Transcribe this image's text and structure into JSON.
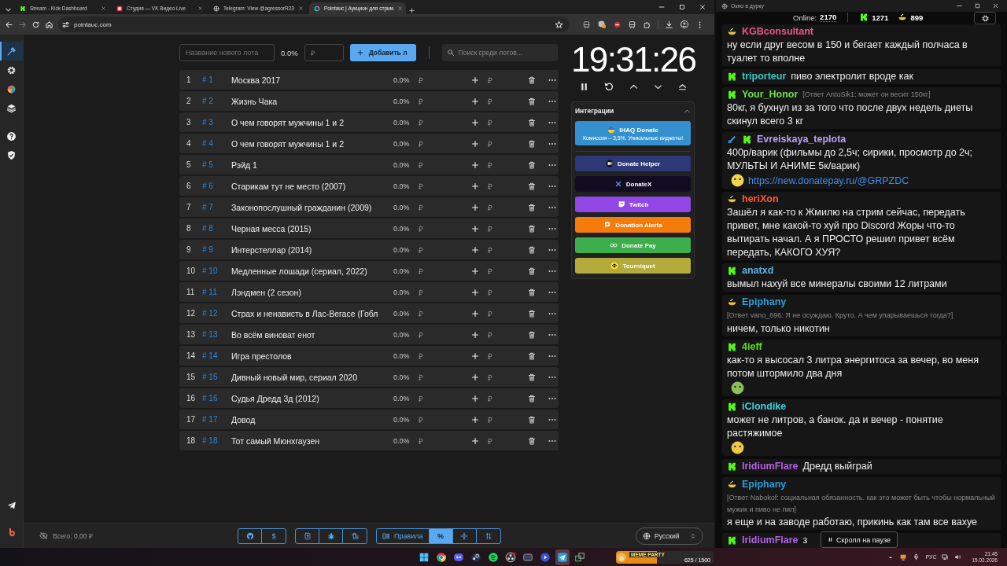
{
  "browser": {
    "tabs": [
      {
        "title": "Stream - Kick Dashboard",
        "selected": false
      },
      {
        "title": "Студия — VK Видео Live",
        "selected": false
      },
      {
        "title": "Telegram: View @agressorR23",
        "selected": false
      },
      {
        "title": "Pointauc | Аукцион для стрим",
        "selected": true
      }
    ],
    "url": "pointauc.com"
  },
  "auction": {
    "sidebar": {
      "items": [
        {
          "selected": true
        },
        {
          "selected": false
        },
        {
          "selected": false
        },
        {
          "selected": false
        }
      ]
    },
    "new_lot": {
      "name_placeholder": "Название нового лота",
      "percent": "0.0%",
      "amount_placeholder": "₽",
      "add_button": "Добавить л"
    },
    "search": {
      "placeholder": "Поиск среди лотов..."
    },
    "lots": [
      {
        "number": "1",
        "id": "# 1",
        "name": "Москва 2017",
        "percent": "0.0%",
        "currency": "₽",
        "add_placeholder": "₽"
      },
      {
        "number": "2",
        "id": "# 2",
        "name": "Жизнь Чака",
        "percent": "0.0%",
        "currency": "₽",
        "add_placeholder": "₽"
      },
      {
        "number": "3",
        "id": "# 3",
        "name": "О чем говорят мужчины 1 и 2",
        "percent": "0.0%",
        "currency": "₽",
        "add_placeholder": "₽"
      },
      {
        "number": "4",
        "id": "# 4",
        "name": "О чем говорят мужчины 1 и 2",
        "percent": "0.0%",
        "currency": "₽",
        "add_placeholder": "₽"
      },
      {
        "number": "5",
        "id": "# 5",
        "name": "Рэйд 1",
        "percent": "0.0%",
        "currency": "₽",
        "add_placeholder": "₽"
      },
      {
        "number": "6",
        "id": "# 6",
        "name": "Старикам тут не место (2007)",
        "percent": "0.0%",
        "currency": "₽",
        "add_placeholder": "₽"
      },
      {
        "number": "7",
        "id": "# 7",
        "name": "Законопослушный гражданин (2009)",
        "percent": "0.0%",
        "currency": "₽",
        "add_placeholder": "₽"
      },
      {
        "number": "8",
        "id": "# 8",
        "name": "Черная месса (2015)",
        "percent": "0.0%",
        "currency": "₽",
        "add_placeholder": "₽"
      },
      {
        "number": "9",
        "id": "# 9",
        "name": "Интерстеллар (2014)",
        "percent": "0.0%",
        "currency": "₽",
        "add_placeholder": "₽"
      },
      {
        "number": "10",
        "id": "# 10",
        "name": "Медленные лошади (сериал, 2022)",
        "percent": "0.0%",
        "currency": "₽",
        "add_placeholder": "₽"
      },
      {
        "number": "11",
        "id": "# 11",
        "name": "Лэндмен (2 сезон)",
        "percent": "0.0%",
        "currency": "₽",
        "add_placeholder": "₽"
      },
      {
        "number": "12",
        "id": "# 12",
        "name": "Страх и ненависть в Лас-Вегасе (Гобл",
        "percent": "0.0%",
        "currency": "₽",
        "add_placeholder": "₽"
      },
      {
        "number": "13",
        "id": "# 13",
        "name": "Во всём виноват енот",
        "percent": "0.0%",
        "currency": "₽",
        "add_placeholder": "₽"
      },
      {
        "number": "14",
        "id": "# 14",
        "name": "Игра престолов",
        "percent": "0.0%",
        "currency": "₽",
        "add_placeholder": "₽"
      },
      {
        "number": "15",
        "id": "# 15",
        "name": "Дивный новый мир, сериал 2020",
        "percent": "0.0%",
        "currency": "₽",
        "add_placeholder": "₽"
      },
      {
        "number": "16",
        "id": "# 16",
        "name": "Судья Дредд 3д (2012)",
        "percent": "0.0%",
        "currency": "₽",
        "add_placeholder": "₽"
      },
      {
        "number": "17",
        "id": "# 17",
        "name": "Довод",
        "percent": "0.0%",
        "currency": "₽",
        "add_placeholder": "₽"
      },
      {
        "number": "18",
        "id": "# 18",
        "name": "Тот самый Мюнхгаузен",
        "percent": "0.0%",
        "currency": "₽",
        "add_placeholder": "₽"
      }
    ],
    "timer": "19:31:26",
    "integrations": {
      "title": "Интеграции",
      "expanded": true,
      "items": [
        {
          "label": "IHAQ Donate",
          "subtitle": "Комиссия – 3,5%. Уникальные виджеты!",
          "color": "#3590d0"
        },
        {
          "label": "Donate Helper",
          "color": "#2d3876"
        },
        {
          "label": "DonateX",
          "color": "#120c22"
        },
        {
          "label": "Twitch",
          "color": "#9146e6"
        },
        {
          "label": "Donation Alerts",
          "color": "#f57c0a"
        },
        {
          "label": "Donate Pay",
          "color": "#3dae4c"
        },
        {
          "label": "Tourniquet",
          "color": "#b5ab3c"
        }
      ]
    },
    "bottom_bar": {
      "total": "Всего: 0,00 ₽",
      "groups": [
        {
          "buttons": [
            {
              "kind": "icon"
            },
            {
              "kind": "text",
              "label": "$"
            }
          ]
        },
        {
          "buttons": [
            {
              "kind": "icon"
            },
            {
              "kind": "icon"
            },
            {
              "kind": "icon"
            }
          ]
        },
        {
          "buttons": [
            {
              "kind": "text",
              "label": "Правила",
              "selected": false
            },
            {
              "kind": "text",
              "label": "%",
              "selected": true
            },
            {
              "kind": "icon",
              "selected": false
            },
            {
              "kind": "icon",
              "selected": false
            }
          ]
        }
      ],
      "language": "Русский"
    }
  },
  "chat": {
    "title": "Окно в дурку",
    "online_label": "Online:",
    "online": "2170",
    "kick_viewers": "1271",
    "other_viewers": "899",
    "messages": [
      {
        "badges": [
          {
            "kind": "bowl"
          }
        ],
        "user": "KGBconsultant",
        "color": "#e8578a",
        "parts": [
          {
            "kind": "text",
            "text": "ну если друг весом в 150 и бегает каждый полчаса в туалет то вполне"
          }
        ]
      },
      {
        "badges": [
          {
            "kind": "kick"
          }
        ],
        "user": "triporteur",
        "color": "#3ec6c2",
        "parts": [
          {
            "kind": "text",
            "text": "пиво электролит вроде как"
          }
        ]
      },
      {
        "badges": [
          {
            "kind": "kick"
          }
        ],
        "user": "Your_Honor",
        "color": "#6ee04c",
        "reply": "[Ответ AntoSik1: может он весит 150кг]",
        "parts": [
          {
            "kind": "text",
            "text": "80кг, я бухнул из за того что после двух недель диеты скинул всего 3 кг"
          }
        ]
      },
      {
        "badges": [
          {
            "kind": "sword"
          },
          {
            "kind": "kick"
          }
        ],
        "user": "Evreiskaya_teplota",
        "color": "#b8a2f5",
        "parts": [
          {
            "kind": "text",
            "text": "400р/варик (фильмы до 2,5ч; сирики, просмотр до 2ч; МУЛЬТЫ И АНИМЕ 5к/варик)"
          },
          {
            "kind": "emote",
            "color": "#f2d64a"
          },
          {
            "kind": "link",
            "text": "https://new.donatepay.ru/@GRPZDC"
          }
        ]
      },
      {
        "badges": [
          {
            "kind": "bowl"
          }
        ],
        "user": "heriXon",
        "color": "#ff5a35",
        "parts": [
          {
            "kind": "text",
            "text": "Зашёл я как-то к Жмилю на стрим сейчас, передать привет, мне какой-то хуй про Discord Жоры что-то вытирать начал. А я ПРОСТО решил привет всём передать, КАКОГО ХУЯ?"
          }
        ]
      },
      {
        "badges": [
          {
            "kind": "kick"
          }
        ],
        "user": "anatxd",
        "color": "#5ab2e2",
        "parts": [
          {
            "kind": "text",
            "text": "вымыл нахуй все минералы своими 12 литрами"
          }
        ]
      },
      {
        "badges": [
          {
            "kind": "bowl"
          }
        ],
        "user": "Epiphany",
        "color": "#2a9fd6",
        "reply": "[Ответ vano_696: Я не осуждаю. Круто. А чем упарываешься тогда?]",
        "parts": [
          {
            "kind": "text",
            "text": "ничем, только никотин"
          }
        ]
      },
      {
        "badges": [
          {
            "kind": "kick"
          }
        ],
        "user": "4ieff",
        "color": "#55e01c",
        "parts": [
          {
            "kind": "text",
            "text": "как-то я высосал 3 литра энергитоса за вечер, во меня потом штормило два дня"
          },
          {
            "kind": "emote",
            "color": "#8cbf5a"
          }
        ]
      },
      {
        "badges": [
          {
            "kind": "kick"
          }
        ],
        "user": "iClondike",
        "color": "#3fd0e0",
        "parts": [
          {
            "kind": "text",
            "text": "может не литров, а банок. да и вечер - понятие растяжимое"
          },
          {
            "kind": "emote",
            "color": "#f3c744"
          }
        ]
      },
      {
        "badges": [
          {
            "kind": "kick"
          }
        ],
        "user": "IridiumFlare",
        "color": "#b462e2",
        "parts": [
          {
            "kind": "text",
            "text": "Дредд выйграй"
          }
        ]
      },
      {
        "badges": [
          {
            "kind": "bowl"
          }
        ],
        "user": "Epiphany",
        "color": "#2a9fd6",
        "reply": "[Ответ Nabokof: социальная обязанность. как это может быть чтобы нормальный мужик и пиво не пил]",
        "parts": [
          {
            "kind": "text",
            "text": "я еще и на заводе работаю, прикинь как там все вахуе"
          }
        ]
      },
      {
        "badges": [
          {
            "kind": "kick"
          }
        ],
        "user": "IridiumFlare",
        "color": "#b462e2",
        "parts": [
          {
            "kind": "text",
            "text": "з"
          }
        ]
      }
    ],
    "scroll_notice": "Скролл на паузе"
  },
  "taskbar": {
    "apps": [
      {
        "selected": false
      },
      {
        "selected": false
      },
      {
        "selected": false
      },
      {
        "selected": false
      },
      {
        "selected": false
      },
      {
        "selected": false
      },
      {
        "selected": false
      },
      {
        "selected": false
      },
      {
        "selected": true
      },
      {
        "selected": false
      }
    ],
    "widget": {
      "title": "MEME PARTY",
      "progress": "625 / 1500",
      "level": 0.42
    },
    "language": "РУС",
    "time": "21:45",
    "date": "15.02.2026"
  }
}
